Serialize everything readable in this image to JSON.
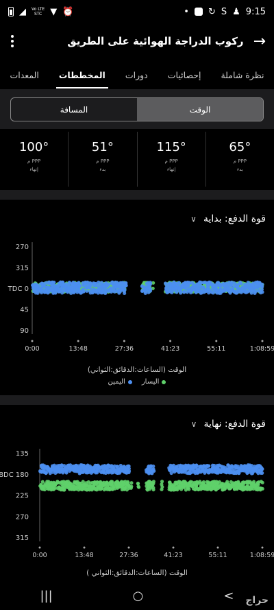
{
  "status": {
    "time": "9:15",
    "carrier_line1": "Vo LTE",
    "carrier_line2": "STC"
  },
  "header": {
    "title": "ركوب الدراجة الهوائية على الطريق"
  },
  "tabs": [
    {
      "label": "نظرة شاملة",
      "active": false
    },
    {
      "label": "إحصائيات",
      "active": false
    },
    {
      "label": "دورات",
      "active": false
    },
    {
      "label": "المخططات",
      "active": true
    },
    {
      "label": "المعدات",
      "active": false
    }
  ],
  "toggle": {
    "time_label": "الوقت",
    "distance_label": "المسافة",
    "selected": "time"
  },
  "stats": [
    {
      "value": "65°",
      "unit": "م PPP",
      "sub": "بدء"
    },
    {
      "value": "115°",
      "unit": "م PPP",
      "sub": "إنهاء"
    },
    {
      "value": "51°",
      "unit": "م PPP",
      "sub": "بدء"
    },
    {
      "value": "100°",
      "unit": "م PPP",
      "sub": "إنهاء"
    }
  ],
  "colors": {
    "left": "#5fd06a",
    "right": "#4d8ff0"
  },
  "chart_data": [
    {
      "type": "scatter",
      "title": "قوة الدفع: بداية",
      "xlabel": "الوقت (الساعات:الدقائق:الثواني)",
      "x_ticks": [
        "0:00",
        "13:48",
        "27:36",
        "41:23",
        "55:11",
        "1:08:59"
      ],
      "y_ticks": [
        "270",
        "315",
        "TDC 0",
        "45",
        "90"
      ],
      "y_tick_values": [
        270,
        315,
        360,
        405,
        450
      ],
      "series": [
        {
          "name": "اليسار",
          "color": "#5fd06a",
          "center": 358,
          "spread": 10
        },
        {
          "name": "اليمين",
          "color": "#4d8ff0",
          "center": 359,
          "spread": 12
        }
      ],
      "gaps": [
        [
          28,
          33
        ],
        [
          35.5,
          40
        ]
      ],
      "x_max_minutes": 69
    },
    {
      "type": "scatter",
      "title": "قوة الدفع: نهاية",
      "xlabel": "الوقت (الساعات:الدقائق:الثواني)",
      "x_ticks": [
        "0:00",
        "13:48",
        "27:36",
        "41:23",
        "55:11",
        "1:08:59"
      ],
      "y_ticks": [
        "135",
        "BDC 180",
        "225",
        "270",
        "315"
      ],
      "y_tick_values": [
        135,
        180,
        225,
        270,
        315
      ],
      "series": [
        {
          "name": "اليسار",
          "color": "#5fd06a",
          "center": 205,
          "spread": 9
        },
        {
          "name": "اليمين",
          "color": "#4d8ff0",
          "center": 170,
          "spread": 9
        }
      ],
      "gaps": [
        [
          28,
          33
        ],
        [
          35.5,
          40
        ]
      ],
      "x_max_minutes": 69
    }
  ],
  "legend": {
    "left": "اليسار",
    "right": "اليمين"
  },
  "partial_axis_label": "الوقت (الساعات:الدقائق:الثواني )",
  "nav": {
    "recents": "|||",
    "home": "○",
    "back": "<"
  },
  "watermark": "حراج"
}
